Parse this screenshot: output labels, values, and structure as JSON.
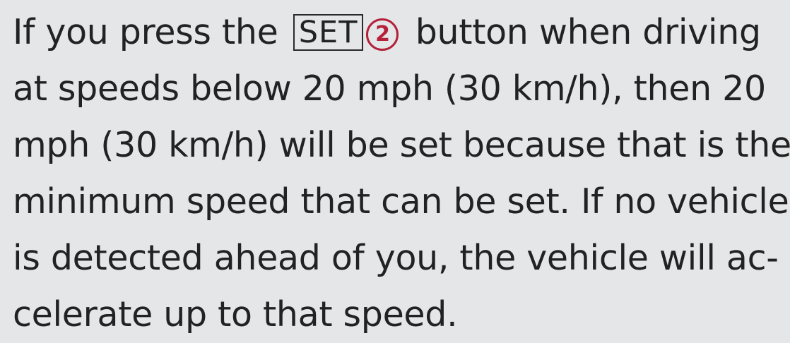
{
  "paragraph": {
    "line1_before": "If you press the",
    "key_label": "SET",
    "callout_number": "2",
    "line1_after": "button when driving",
    "line2": "at speeds below 20 mph (30 km/h), then 20",
    "line3": "mph (30 km/h) will be set because that is the",
    "line4": "minimum speed that can be set. If no vehicle",
    "line5": "is detected ahead of you, the vehicle will ac-",
    "line6": "celerate up to that speed."
  },
  "colors": {
    "background": "#e4e6e8",
    "text": "#222222",
    "callout": "#b5203a"
  }
}
